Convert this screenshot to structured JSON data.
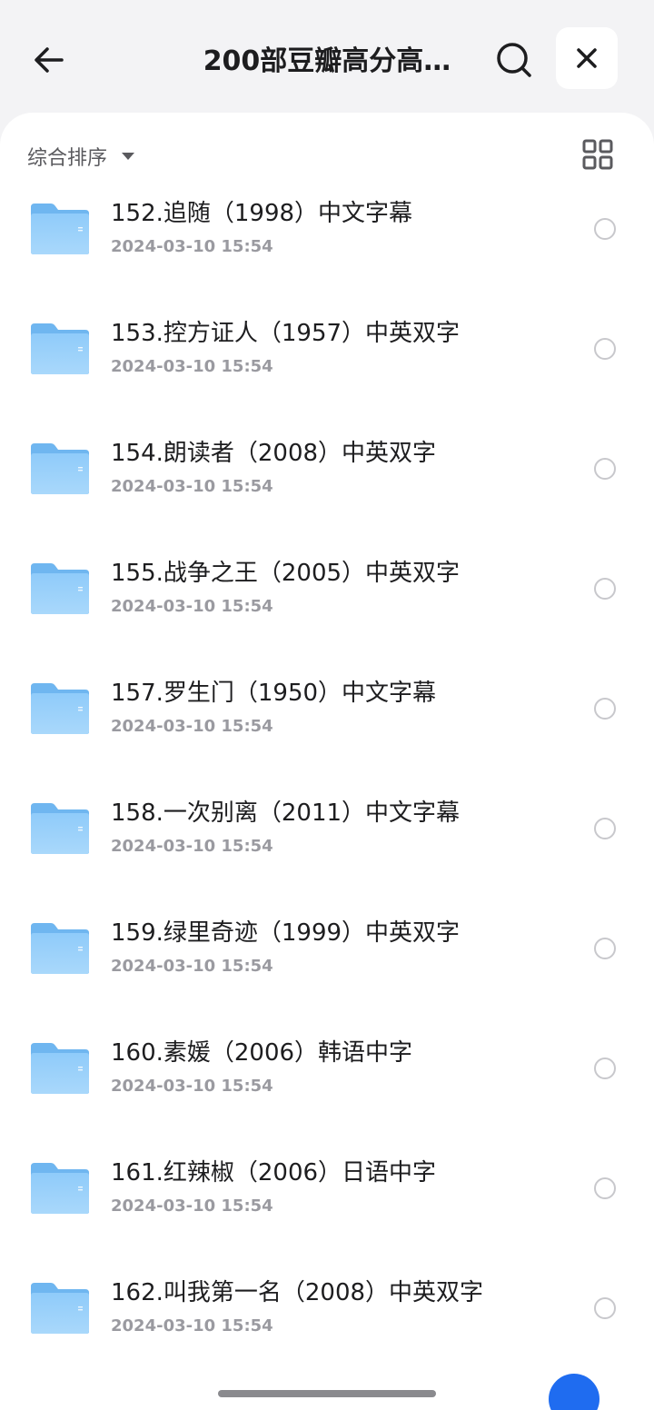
{
  "header": {
    "title": "200部豆瓣高分高…",
    "back_icon": "arrow-left-icon",
    "search_icon": "search-icon",
    "close_icon": "close-icon"
  },
  "toolbar": {
    "sort_label": "综合排序",
    "view_icon": "grid-view-icon"
  },
  "colors": {
    "folder": "#7cc0f5",
    "accent": "#1f6cf0"
  },
  "files": [
    {
      "name": "152.追随（1998）中文字幕",
      "date": "2024-03-10 15:54"
    },
    {
      "name": "153.控方证人（1957）中英双字",
      "date": "2024-03-10 15:54"
    },
    {
      "name": "154.朗读者（2008）中英双字",
      "date": "2024-03-10 15:54"
    },
    {
      "name": "155.战争之王（2005）中英双字",
      "date": "2024-03-10 15:54"
    },
    {
      "name": "157.罗生门（1950）中文字幕",
      "date": "2024-03-10 15:54"
    },
    {
      "name": "158.一次别离（2011）中文字幕",
      "date": "2024-03-10 15:54"
    },
    {
      "name": "159.绿里奇迹（1999）中英双字",
      "date": "2024-03-10 15:54"
    },
    {
      "name": "160.素媛（2006）韩语中字",
      "date": "2024-03-10 15:54"
    },
    {
      "name": "161.红辣椒（2006）日语中字",
      "date": "2024-03-10 15:54"
    },
    {
      "name": "162.叫我第一名（2008）中英双字",
      "date": "2024-03-10 15:54"
    }
  ]
}
